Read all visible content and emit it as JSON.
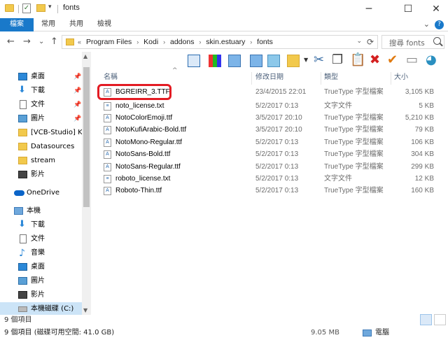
{
  "window": {
    "title": "fonts",
    "minimize": "─",
    "maximize": "☐",
    "close": "✕"
  },
  "ribbon": {
    "tabs": [
      "檔案",
      "常用",
      "共用",
      "檢視"
    ],
    "expand": "⌄",
    "help": "?"
  },
  "nav": {
    "back": "←",
    "forward": "→",
    "recent": "⌄",
    "up": "↑"
  },
  "address": {
    "overflow": "«",
    "crumbs": [
      "Program Files",
      "Kodi",
      "addons",
      "skin.estuary",
      "fonts"
    ],
    "separator": "›",
    "dropdown": "⌄",
    "refresh": "⟳"
  },
  "search": {
    "placeholder": "搜尋 fonts"
  },
  "sidebar": {
    "items": [
      {
        "label": "桌面",
        "icon": "desktop-icon",
        "pinned": true
      },
      {
        "label": "下載",
        "icon": "download-icon",
        "pinned": true
      },
      {
        "label": "文件",
        "icon": "document-icon",
        "pinned": true
      },
      {
        "label": "圖片",
        "icon": "picture-icon",
        "pinned": true
      },
      {
        "label": "[VCB-Studio] Ki",
        "icon": "folder-icon",
        "pinned": false
      },
      {
        "label": "Datasources",
        "icon": "folder-icon",
        "pinned": false
      },
      {
        "label": "stream",
        "icon": "folder-icon",
        "pinned": false
      },
      {
        "label": "影片",
        "icon": "video-icon",
        "pinned": false
      },
      {
        "label": "OneDrive",
        "icon": "onedrive-icon",
        "pinned": false
      },
      {
        "label": "本機",
        "icon": "pc-icon",
        "pinned": false
      },
      {
        "label": "下載",
        "icon": "download-icon",
        "pinned": false
      },
      {
        "label": "文件",
        "icon": "document-icon",
        "pinned": false
      },
      {
        "label": "音樂",
        "icon": "music-icon",
        "pinned": false
      },
      {
        "label": "桌面",
        "icon": "desktop-icon",
        "pinned": false
      },
      {
        "label": "圖片",
        "icon": "picture-icon",
        "pinned": false
      },
      {
        "label": "影片",
        "icon": "video-icon",
        "pinned": false
      },
      {
        "label": "本機磁碟 (C:)",
        "icon": "drive-icon",
        "pinned": false
      }
    ],
    "pin_glyph": "📌"
  },
  "columns": {
    "name": "名稱",
    "date": "修改日期",
    "type": "類型",
    "size": "大小",
    "sort_glyph": "^"
  },
  "files": [
    {
      "name": "BGREIRR_3.TTF",
      "date": "23/4/2015 22:01",
      "type": "TrueType 字型檔案",
      "size": "3,105 KB",
      "kind": "font"
    },
    {
      "name": "noto_license.txt",
      "date": "5/2/2017 0:13",
      "type": "文字文件",
      "size": "5 KB",
      "kind": "text"
    },
    {
      "name": "NotoColorEmoji.ttf",
      "date": "3/5/2017 20:10",
      "type": "TrueType 字型檔案",
      "size": "5,210 KB",
      "kind": "font"
    },
    {
      "name": "NotoKufiArabic-Bold.ttf",
      "date": "3/5/2017 20:10",
      "type": "TrueType 字型檔案",
      "size": "79 KB",
      "kind": "font"
    },
    {
      "name": "NotoMono-Regular.ttf",
      "date": "5/2/2017 0:13",
      "type": "TrueType 字型檔案",
      "size": "106 KB",
      "kind": "font"
    },
    {
      "name": "NotoSans-Bold.ttf",
      "date": "5/2/2017 0:13",
      "type": "TrueType 字型檔案",
      "size": "304 KB",
      "kind": "font"
    },
    {
      "name": "NotoSans-Regular.ttf",
      "date": "5/2/2017 0:13",
      "type": "TrueType 字型檔案",
      "size": "299 KB",
      "kind": "font"
    },
    {
      "name": "roboto_license.txt",
      "date": "5/2/2017 0:13",
      "type": "文字文件",
      "size": "12 KB",
      "kind": "text"
    },
    {
      "name": "Roboto-Thin.ttf",
      "date": "5/2/2017 0:13",
      "type": "TrueType 字型檔案",
      "size": "160 KB",
      "kind": "font"
    }
  ],
  "status": {
    "count": "9 個項目",
    "free_space": "9 個項目 (磁碟可用空間: 41.0 GB)",
    "total_size": "9.05 MB",
    "location": "電腦"
  },
  "colors": {
    "accent": "#1979ca",
    "highlight": "#e31b23",
    "selection": "#cce4f7"
  }
}
